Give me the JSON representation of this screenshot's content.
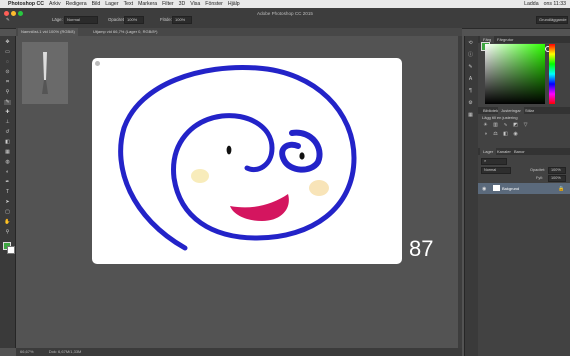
{
  "menubar": {
    "app_name": "Photoshop CC",
    "items": [
      "Arkiv",
      "Redigera",
      "Bild",
      "Lager",
      "Text",
      "Markera",
      "Filter",
      "3D",
      "Visa",
      "Fönster",
      "Hjälp"
    ],
    "clock": "ons 11:33",
    "user": "Ladda"
  },
  "window": {
    "title": "Adobe Photoshop CC 2015",
    "tabs": [
      {
        "label": "Namnlöst-1 vid 100% (RGB/8)"
      },
      {
        "label": "Utjamp vid 66,7% (Lager 0, RGB/8*)"
      }
    ]
  },
  "options": {
    "mode_label": "Läge:",
    "mode_value": "Normal",
    "opacity_label": "Opacitet:",
    "opacity_value": "100%",
    "flow_label": "Flöde:",
    "flow_value": "100%",
    "workspace": "Grundläggande"
  },
  "canvas": {
    "slide_number": "87"
  },
  "status": {
    "zoom": "66,67%",
    "doc": "Dok: 6,67M/1,33M"
  },
  "panels": {
    "color_tabs": [
      "Färg",
      "Färgrutor"
    ],
    "adjust_tabs": [
      "Bibliotek",
      "Justeringar",
      "Stilar"
    ],
    "adjust_label": "Lägg till en justering",
    "layer_tabs": [
      "Lager",
      "Kanaler",
      "Banor"
    ],
    "blend_mode": "Normal",
    "opacity_label": "Opacitet:",
    "opacity_value": "100%",
    "fill_label": "Fyll:",
    "fill_value": "100%",
    "layer_name": "Bakgrund"
  },
  "colors": {
    "foreground": "#3da641",
    "stroke": "#2323c8",
    "mouth": "#d4155f"
  }
}
